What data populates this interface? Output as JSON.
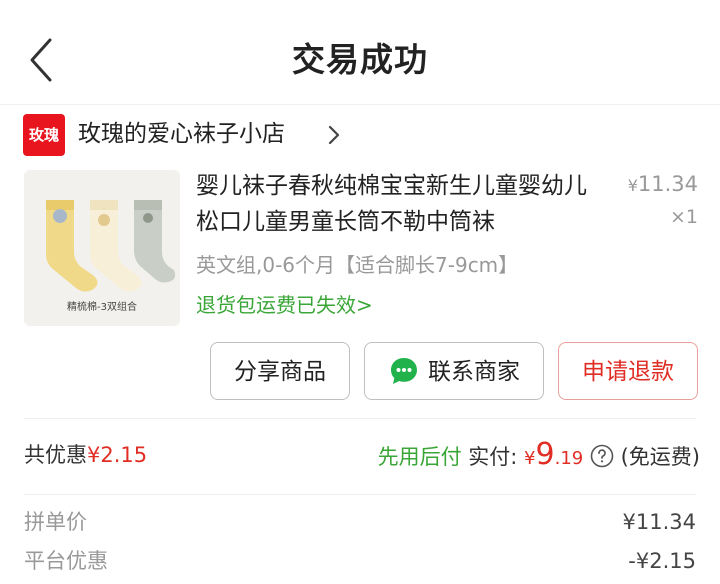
{
  "header": {
    "title": "交易成功",
    "back_icon": "chevron-left-icon"
  },
  "shop": {
    "logo_text": "玫瑰",
    "name": "玫瑰的爱心袜子小店",
    "chevron": "chevron-right-icon",
    "logo_color": "#e8141e"
  },
  "product": {
    "image_caption": "精梳棉-3双组合",
    "title": "婴儿袜子春秋纯棉宝宝新生儿童婴幼儿松口儿童男童长筒不勒中筒袜",
    "price_symbol": "¥",
    "price": "11.34",
    "quantity": "×1",
    "spec": "英文组,0-6个月【适合脚长7-9cm】",
    "return_note": "退货包运费已失效>"
  },
  "actions": {
    "share": "分享商品",
    "contact": "联系商家",
    "refund": "申请退款"
  },
  "summary": {
    "discount_label": "共优惠",
    "discount_value": "¥2.15",
    "pay_later": "先用后付",
    "paid_label": "实付:",
    "paid_symbol": "¥",
    "paid_integer": "9",
    "paid_decimal": ".19",
    "shipping": "(免运费)"
  },
  "details": [
    {
      "label": "拼单价",
      "value": "¥11.34"
    },
    {
      "label": "平台优惠",
      "value": "-¥2.15"
    }
  ],
  "colors": {
    "accent_red": "#e02e24",
    "green": "#3aa637",
    "muted": "#999999"
  }
}
